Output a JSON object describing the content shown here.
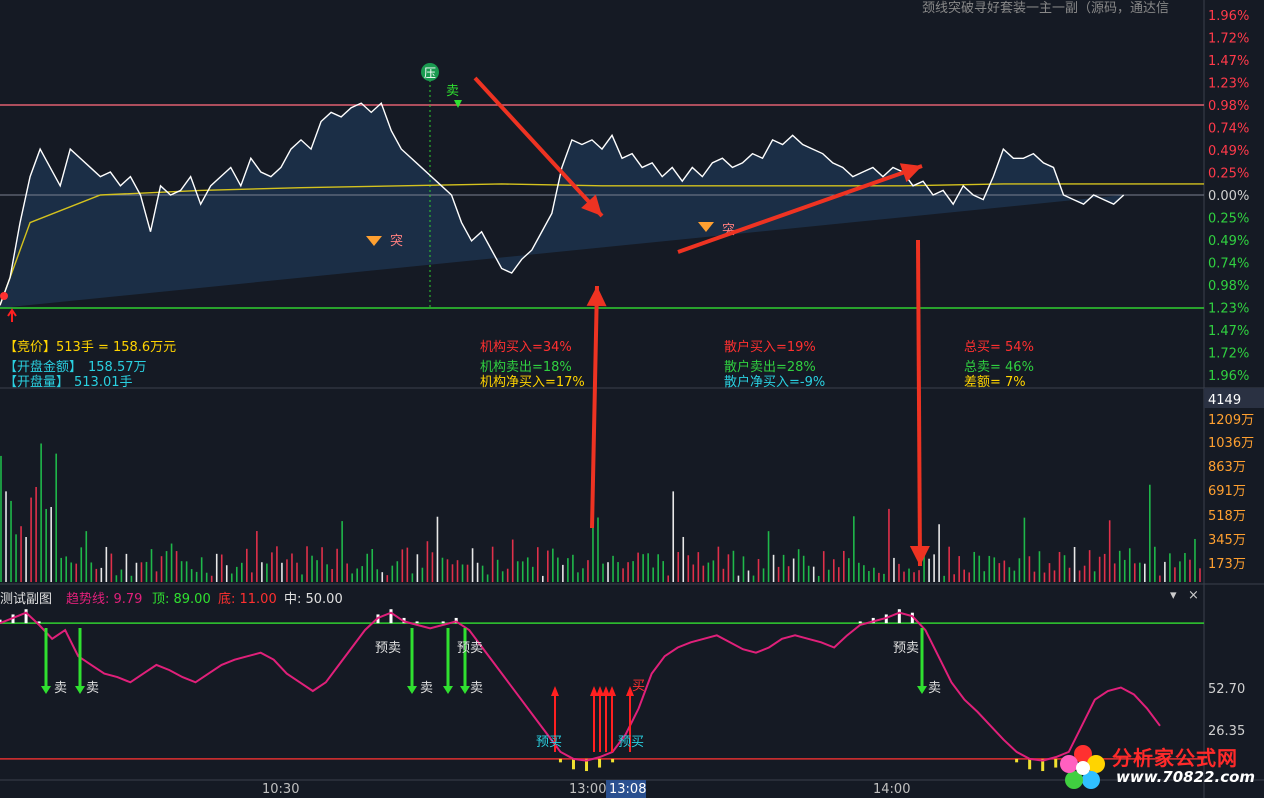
{
  "header_fragment": "颈线突破寻好套装一主一副（源码，通达信",
  "price_axis": [
    "1.96%",
    "1.72%",
    "1.47%",
    "1.23%",
    "0.98%",
    "0.74%",
    "0.49%",
    "0.25%",
    "0.00%",
    "0.25%",
    "0.49%",
    "0.74%",
    "0.98%",
    "1.23%",
    "1.47%",
    "1.72%",
    "1.96%"
  ],
  "volume_axis": [
    "4149",
    "1209万",
    "1036万",
    "863万",
    "691万",
    "518万",
    "345万",
    "173万"
  ],
  "sub_axis": [
    "52.70",
    "26.35"
  ],
  "time_axis": [
    "10:30",
    "13:00",
    "13:08",
    "14:00"
  ],
  "info_left": {
    "line1": "【竞价】513手 = 158.6万元",
    "line2_label": "【开盘金额】",
    "line2_value": "158.57万",
    "line3_label": "【开盘量】",
    "line3_value": "513.01手"
  },
  "info_inst": {
    "buy": "机构买入=34%",
    "sell": "机构卖出=18%",
    "net": "机构净买入=17%"
  },
  "info_retail": {
    "buy": "散户买入=19%",
    "sell": "散户卖出=28%",
    "net": "散户净买入=-9%"
  },
  "info_total": {
    "buy": "总买= 54%",
    "sell": "总卖= 46%",
    "diff": "差额= 7%"
  },
  "markers": {
    "press": "压",
    "sell": "卖",
    "breakout": "突",
    "presell": "预卖",
    "prebuy": "预买",
    "buy": "买"
  },
  "sub_chart": {
    "title": "测试副图",
    "trend_label": "趋势线: 9.79",
    "top_label": "顶: 89.00",
    "bottom_label": "底: 11.00",
    "mid_label": "中: 50.00"
  },
  "controls": {
    "menu": "▾",
    "close": "×"
  },
  "logo": {
    "name": "分析家公式网",
    "url": "www.70822.com"
  },
  "colors": {
    "background": "#151a24",
    "price": "#ffffff",
    "avg": "#d4c21e",
    "up": "#e0304a",
    "down": "#1fb84a",
    "trend": "#e0207a",
    "arrow": "#ee3322"
  },
  "chart_data": {
    "type": "line",
    "title": "",
    "y_axis": "percent change",
    "ylim": [
      -1.96,
      1.96
    ],
    "series": [
      {
        "x_index": [
          0,
          2,
          4,
          6,
          8,
          10,
          12,
          14,
          16,
          18,
          20,
          22,
          24,
          26,
          28,
          30,
          32,
          34,
          36,
          38,
          40,
          42,
          44,
          46,
          48,
          50,
          52,
          54,
          56,
          58,
          60,
          62,
          64,
          66,
          68,
          70,
          72,
          74,
          76,
          78,
          80,
          82,
          84,
          86,
          88,
          90,
          92,
          94,
          96,
          98,
          100,
          102,
          104,
          106,
          108,
          110,
          112,
          114,
          116,
          118,
          120,
          122,
          124,
          126,
          128,
          130,
          132,
          134,
          136,
          138,
          140,
          142,
          144,
          146,
          148,
          150,
          152,
          154,
          156,
          158,
          160,
          162,
          164,
          166,
          168,
          170,
          172,
          174,
          176,
          178,
          180,
          182,
          184,
          186,
          188,
          190,
          192,
          194,
          196,
          198,
          200,
          202,
          204,
          206,
          208,
          210,
          212,
          214,
          216,
          218,
          220,
          222,
          224,
          226,
          228,
          230,
          232,
          234,
          236,
          238,
          240
        ],
        "values": [
          -1.2,
          -0.9,
          -0.3,
          0.2,
          0.5,
          0.3,
          0.1,
          0.5,
          0.4,
          0.3,
          0.2,
          0.25,
          0.1,
          0.2,
          0.0,
          -0.4,
          0.1,
          0.0,
          0.05,
          0.2,
          -0.1,
          0.1,
          0.2,
          0.3,
          0.1,
          0.4,
          0.25,
          0.2,
          0.3,
          0.5,
          0.6,
          0.5,
          0.8,
          0.9,
          0.85,
          0.95,
          1.0,
          0.9,
          1.0,
          0.7,
          0.5,
          0.4,
          0.3,
          0.2,
          0.1,
          0.0,
          -0.3,
          -0.5,
          -0.4,
          -0.6,
          -0.8,
          -0.85,
          -0.7,
          -0.6,
          -0.4,
          -0.2,
          0.3,
          0.6,
          0.55,
          0.6,
          0.5,
          0.65,
          0.4,
          0.45,
          0.3,
          0.35,
          0.2,
          0.3,
          0.15,
          0.3,
          0.2,
          0.35,
          0.4,
          0.3,
          0.35,
          0.45,
          0.4,
          0.6,
          0.55,
          0.65,
          0.55,
          0.5,
          0.45,
          0.35,
          0.3,
          0.2,
          0.25,
          0.3,
          0.2,
          0.3,
          0.25,
          0.1,
          0.15,
          0.0,
          0.05,
          -0.1,
          0.1,
          0.0,
          -0.05,
          0.2,
          0.5,
          0.4,
          0.4,
          0.45,
          0.35,
          0.3,
          0.0,
          -0.05,
          -0.1,
          0.0,
          -0.05,
          -0.1,
          0.0
        ],
        "color": "#ffffff"
      },
      {
        "x_index": [
          0,
          6,
          20,
          40,
          60,
          80,
          100,
          120,
          140,
          160,
          180,
          200,
          220,
          240
        ],
        "values": [
          -1.2,
          -0.3,
          0.0,
          0.05,
          0.08,
          0.1,
          0.12,
          0.1,
          0.1,
          0.1,
          0.1,
          0.12,
          0.12,
          0.12
        ],
        "color": "#d4c21e"
      }
    ],
    "reference_lines": {
      "upper": 0.98,
      "zero": 0.0,
      "lower": -1.23
    },
    "sub_series": {
      "ylim": [
        0,
        100
      ],
      "top": 89,
      "bottom": 11,
      "mid": 50,
      "current": 9.79,
      "values": [
        89,
        92,
        95,
        88,
        80,
        85,
        70,
        65,
        60,
        58,
        55,
        60,
        65,
        62,
        58,
        55,
        60,
        65,
        68,
        70,
        72,
        68,
        60,
        55,
        50,
        55,
        65,
        75,
        85,
        92,
        95,
        90,
        88,
        86,
        88,
        90,
        85,
        75,
        65,
        55,
        45,
        35,
        25,
        15,
        11,
        10,
        12,
        15,
        25,
        40,
        60,
        70,
        75,
        78,
        80,
        82,
        78,
        74,
        72,
        75,
        80,
        82,
        80,
        78,
        75,
        82,
        88,
        90,
        92,
        95,
        93,
        85,
        70,
        55,
        45,
        38,
        30,
        22,
        15,
        11,
        10,
        12,
        15,
        30,
        45,
        50,
        52,
        48,
        40,
        30
      ]
    }
  }
}
